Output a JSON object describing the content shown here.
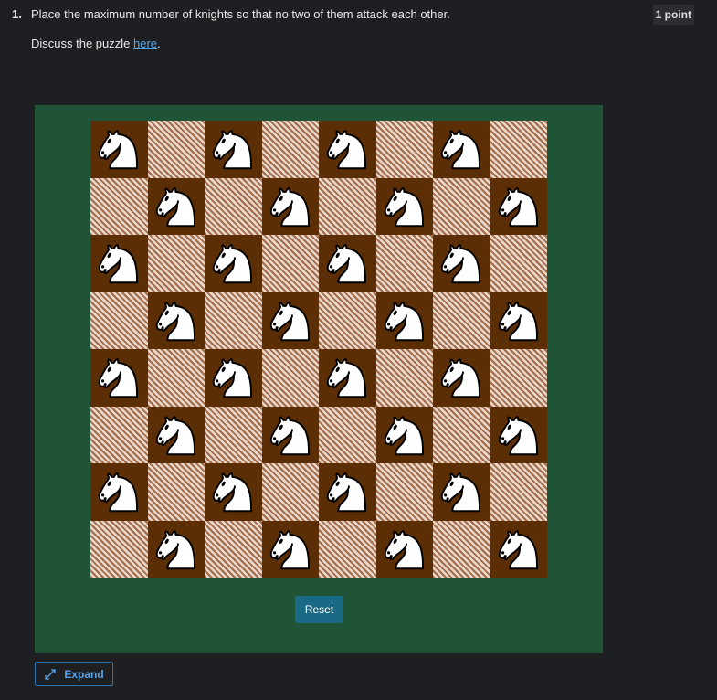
{
  "question": {
    "number": "1.",
    "text": "Place the maximum number of knights so that no two of them attack each other.",
    "points": "1 point"
  },
  "discuss": {
    "prefix": "Discuss the puzzle ",
    "link_text": "here",
    "suffix": "."
  },
  "board": {
    "rows": 8,
    "cols": 8,
    "piece": "white-knight",
    "knight_placement": "all-dark-squares",
    "knight_count": 32,
    "colors": {
      "panel": "#1f5536",
      "dark_square": "#5c2e05",
      "light_square_hatch": "#a36a4a",
      "knight_fill": "#ffffff",
      "knight_outline": "#000000"
    }
  },
  "controls": {
    "reset_label": "Reset",
    "expand_label": "Expand",
    "expand_icon": "expand-arrows-icon"
  }
}
